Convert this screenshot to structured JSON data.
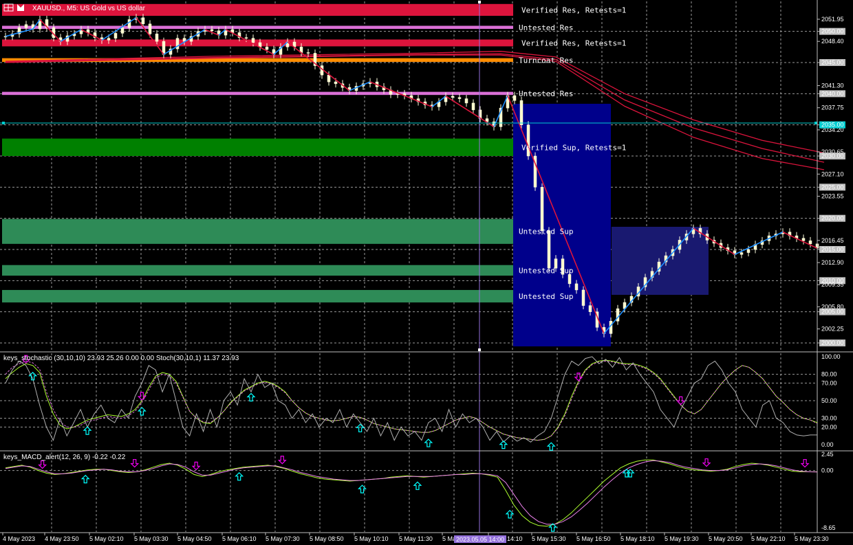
{
  "header": {
    "symbol_title": "XAUUSD., M5:  US Gold vs US dollar",
    "stoch_title": "keys_stochastic (30,10,10) 23.93 25.26 0.00 0.00 Stoch(30,10,1) 11.37 23.93",
    "macd_title": "keys_MACD_alert(12, 26, 9) -0.22 -0.22"
  },
  "colors": {
    "background": "#000000",
    "grid": "#9a9a9a",
    "res_verified": "#dc143c",
    "res_untested": "#da70d6",
    "turncoat": "#ff8c00",
    "sup_verified": "#008000",
    "sup_untested": "#2e8b57",
    "zigzag_up": "#1e90ff",
    "zigzag_down": "#dc143c",
    "ma": "#dc143c",
    "crosshair_h": "#00ced1",
    "crosshair_v": "#9370db",
    "box_a": "#00008b",
    "box_b": "#191970",
    "arrow_up": "#00ffff",
    "arrow_down": "#ee00ee"
  },
  "chart_data": [
    {
      "type": "candlestick",
      "title": "XAUUSD., M5:  US Gold vs US dollar",
      "y_ticks": [
        "2051.95",
        "2050.00",
        "2048.40",
        "2045.00",
        "2041.30",
        "2040.00",
        "2037.75",
        "2035.00",
        "2034.20",
        "2030.65",
        "2030.00",
        "2027.10",
        "2025.00",
        "2023.55",
        "2020.00",
        "2016.45",
        "2015.00",
        "2012.90",
        "2010.00",
        "2009.35",
        "2005.80",
        "2005.00",
        "2002.25",
        "2000.00"
      ],
      "highlighted_ticks": [
        "2050.00",
        "2045.00",
        "2040.00",
        "2035.00",
        "2030.00",
        "2025.00",
        "2020.00",
        "2015.00",
        "2010.00",
        "2005.00",
        "2000.00"
      ],
      "x_labels": [
        "4 May 2023",
        "4 May 23:50",
        "5 May 02:10",
        "5 May 03:30",
        "5 May 04:50",
        "5 May 06:10",
        "5 May 07:30",
        "5 May 08:50",
        "5 May 10:10",
        "5 May 11:30",
        "5 May 12:50",
        "5 May 14:10",
        "5 May 15:30",
        "5 May 16:50",
        "5 May 18:10",
        "5 May 19:30",
        "5 May 20:50",
        "5 May 22:10",
        "5 May 23:30"
      ],
      "crosshair_time": "2023.05.05 14:00",
      "crosshair_price": "2035.00",
      "zones": [
        {
          "kind": "res_verified",
          "label": "Verified Res, Retests=1",
          "from": 2052.5,
          "to": 2054.4
        },
        {
          "kind": "res_untested",
          "label": "Untested Res",
          "from": 2050.4,
          "to": 2050.9
        },
        {
          "kind": "res_verified",
          "label": "Verified Res, Retests=1",
          "from": 2047.6,
          "to": 2048.7
        },
        {
          "kind": "turncoat",
          "label": "Turncoat Res",
          "from": 2045.1,
          "to": 2045.7
        },
        {
          "kind": "res_untested",
          "label": "Untested Res",
          "from": 2039.8,
          "to": 2040.3
        },
        {
          "kind": "sup_verified",
          "label": "Verified Sup, Retests=1",
          "from": 2030.0,
          "to": 2032.8
        },
        {
          "kind": "sup_untested",
          "label": "Untested Sup",
          "from": 2015.9,
          "to": 2019.9
        },
        {
          "kind": "sup_untested",
          "label": "Untested Sup",
          "from": 2010.8,
          "to": 2012.5
        },
        {
          "kind": "sup_untested",
          "label": "Untested Sup",
          "from": 2006.5,
          "to": 2008.5
        }
      ],
      "price_series": [
        2049.2,
        2049.6,
        2050.6,
        2051.1,
        2050.4,
        2051.9,
        2050.6,
        2049.0,
        2048.4,
        2049.3,
        2049.6,
        2050.3,
        2049.8,
        2049.0,
        2048.6,
        2048.9,
        2049.7,
        2050.6,
        2051.9,
        2052.2,
        2051.2,
        2049.6,
        2048.4,
        2046.3,
        2047.2,
        2048.9,
        2048.4,
        2049.2,
        2050.0,
        2050.3,
        2050.1,
        2049.4,
        2050.3,
        2049.8,
        2049.0,
        2048.9,
        2048.2,
        2047.5,
        2047.1,
        2046.3,
        2047.5,
        2048.3,
        2047.5,
        2046.6,
        2046.5,
        2044.5,
        2043.0,
        2041.9,
        2041.6,
        2041.0,
        2040.5,
        2041.2,
        2041.6,
        2041.9,
        2041.1,
        2040.6,
        2039.9,
        2040.0,
        2039.7,
        2039.2,
        2038.7,
        2038.2,
        2037.9,
        2038.7,
        2039.6,
        2039.4,
        2039.2,
        2038.5,
        2037.4,
        2036.0,
        2035.5,
        2034.7,
        2037.7,
        2039.7,
        2038.9,
        2035.0,
        2030.0,
        2025.0,
        2018.0,
        2012.0,
        2013.5,
        2011.0,
        2009.5,
        2008.5,
        2006.0,
        2005.0,
        2002.5,
        2001.5,
        2003.5,
        2005.5,
        2006.5,
        2007.5,
        2009.0,
        2010.5,
        2011.5,
        2013.0,
        2014.0,
        2015.0,
        2016.5,
        2017.5,
        2018.4,
        2017.5,
        2016.5,
        2016.0,
        2015.3,
        2014.8,
        2014.2,
        2014.5,
        2015.0,
        2015.8,
        2016.4,
        2017.2,
        2017.5,
        2017.8,
        2017.2,
        2016.8,
        2016.4,
        2015.9,
        2015.2
      ],
      "moving_averages": [
        {
          "points": [
            [
              0,
              2045.2
            ],
            [
              30,
              2046.0
            ],
            [
              60,
              2046.5
            ],
            [
              72,
              2046.8
            ],
            [
              80,
              2045.9
            ],
            [
              90,
              2040.0
            ],
            [
              100,
              2035.8
            ],
            [
              110,
              2032.5
            ],
            [
              119,
              2030.5
            ]
          ]
        },
        {
          "points": [
            [
              0,
              2045.1
            ],
            [
              30,
              2045.8
            ],
            [
              60,
              2046.3
            ],
            [
              72,
              2046.4
            ],
            [
              80,
              2045.5
            ],
            [
              90,
              2039.0
            ],
            [
              100,
              2034.5
            ],
            [
              110,
              2031.2
            ],
            [
              119,
              2029.0
            ]
          ]
        },
        {
          "points": [
            [
              0,
              2045.0
            ],
            [
              30,
              2045.7
            ],
            [
              60,
              2046.2
            ],
            [
              72,
              2046.2
            ],
            [
              80,
              2045.2
            ],
            [
              90,
              2038.0
            ],
            [
              100,
              2033.0
            ],
            [
              110,
              2029.6
            ],
            [
              119,
              2027.8
            ]
          ]
        }
      ]
    },
    {
      "type": "line",
      "title": "keys_stochastic (30,10,10) 23.93 25.26 0.00 0.00 Stoch(30,10,1) 11.37 23.93",
      "y_ticks": [
        "100.00",
        "80.00",
        "70.00",
        "50.00",
        "30.00",
        "20.00",
        "0.00"
      ],
      "ylim": [
        0,
        100
      ],
      "series": [
        {
          "values": [
            75,
            82,
            88,
            92,
            90,
            82,
            55,
            35,
            22,
            18,
            20,
            24,
            28,
            30,
            32,
            34,
            33,
            32,
            35,
            40,
            50,
            65,
            78,
            82,
            80,
            72,
            55,
            38,
            30,
            25,
            24,
            30,
            38,
            48,
            55,
            62,
            66,
            70,
            72,
            70,
            66,
            60,
            50,
            42,
            36,
            32,
            30,
            28,
            27,
            28,
            30,
            32,
            31,
            28,
            24,
            22,
            20,
            18,
            17,
            16,
            15,
            14,
            14,
            16,
            20,
            24,
            28,
            30,
            32,
            30,
            25,
            20,
            16,
            12,
            10,
            8,
            7,
            6,
            5,
            6,
            10,
            20,
            35,
            55,
            72,
            85,
            92,
            95,
            96,
            95,
            93,
            92,
            92,
            90,
            87,
            82,
            75,
            65,
            55,
            45,
            38,
            35,
            40,
            50,
            60,
            70,
            78,
            85,
            90,
            88,
            82,
            75,
            65,
            55,
            48,
            40,
            34,
            30,
            28,
            25
          ]
        },
        {
          "values": [
            80,
            88,
            92,
            95,
            93,
            86,
            60,
            40,
            26,
            20,
            20,
            22,
            26,
            28,
            30,
            32,
            31,
            30,
            33,
            38,
            48,
            62,
            76,
            80,
            78,
            70,
            54,
            38,
            30,
            26,
            25,
            30,
            38,
            47,
            54,
            61,
            65,
            69,
            71,
            69,
            65,
            59,
            50,
            42,
            36,
            32,
            30,
            28,
            27,
            28,
            30,
            32,
            31,
            28,
            24,
            22,
            20,
            18,
            17,
            16,
            15,
            14,
            14,
            16,
            20,
            24,
            28,
            30,
            32,
            30,
            25,
            20,
            16,
            12,
            10,
            8,
            7,
            6,
            5,
            6,
            10,
            19,
            33,
            52,
            70,
            84,
            91,
            94,
            95,
            94,
            92,
            91,
            91,
            89,
            86,
            81,
            74,
            64,
            54,
            45,
            38,
            35,
            40,
            50,
            60,
            70,
            78,
            85,
            90,
            88,
            82,
            75,
            65,
            55,
            48,
            40,
            34,
            30,
            28,
            24
          ]
        },
        {
          "values": [
            70,
            85,
            95,
            90,
            75,
            45,
            20,
            5,
            30,
            10,
            25,
            40,
            20,
            35,
            45,
            30,
            25,
            40,
            30,
            55,
            70,
            90,
            85,
            60,
            80,
            50,
            20,
            10,
            35,
            15,
            40,
            20,
            50,
            60,
            45,
            75,
            60,
            80,
            65,
            70,
            50,
            45,
            30,
            40,
            25,
            35,
            20,
            30,
            25,
            40,
            20,
            35,
            25,
            15,
            30,
            10,
            25,
            5,
            20,
            10,
            15,
            5,
            25,
            30,
            15,
            40,
            20,
            35,
            25,
            30,
            20,
            5,
            15,
            3,
            10,
            4,
            8,
            3,
            10,
            15,
            30,
            55,
            80,
            95,
            90,
            98,
            100,
            92,
            97,
            88,
            99,
            85,
            93,
            80,
            70,
            60,
            40,
            30,
            20,
            40,
            55,
            70,
            75,
            90,
            95,
            85,
            70,
            60,
            40,
            30,
            20,
            45,
            50,
            30,
            25,
            15,
            11,
            10,
            11,
            11
          ]
        }
      ],
      "arrows_up_x": [
        4,
        12,
        20,
        36,
        52,
        62,
        73,
        80
      ],
      "arrows_down_x": [
        3,
        20,
        84,
        99
      ]
    },
    {
      "type": "line",
      "title": "keys_MACD_alert(12, 26, 9) -0.22 -0.22",
      "y_ticks": [
        "2.45",
        "0.00",
        "-8.65"
      ],
      "ylim": [
        -8.65,
        2.45
      ],
      "series": [
        {
          "values": [
            0.4,
            0.6,
            0.8,
            0.5,
            0.0,
            -0.4,
            -0.6,
            -0.5,
            -0.3,
            -0.1,
            0.1,
            0.2,
            0.2,
            0.0,
            -0.2,
            -0.3,
            -0.2,
            0.1,
            0.5,
            0.9,
            1.1,
            0.8,
            0.2,
            -0.6,
            -0.9,
            -0.6,
            -0.2,
            0.1,
            0.3,
            0.5,
            0.6,
            0.7,
            0.8,
            0.6,
            0.3,
            -0.1,
            -0.5,
            -0.8,
            -1.1,
            -1.3,
            -1.4,
            -1.5,
            -1.6,
            -1.5,
            -1.4,
            -1.3,
            -1.2,
            -1.0,
            -0.9,
            -0.8,
            -0.9,
            -1.0,
            -0.9,
            -0.8,
            -0.7,
            -0.6,
            -0.5,
            -0.4,
            -0.5,
            -0.7,
            -1.0,
            -3.0,
            -5.2,
            -6.8,
            -7.8,
            -8.3,
            -8.4,
            -8.1,
            -7.4,
            -6.4,
            -5.2,
            -4.0,
            -2.8,
            -1.6,
            -0.6,
            0.4,
            1.0,
            1.4,
            1.6,
            1.6,
            1.3,
            1.0,
            0.6,
            0.3,
            0.1,
            0.0,
            -0.1,
            0.0,
            0.2,
            0.6,
            0.9,
            1.1,
            1.0,
            0.8,
            0.5,
            0.2,
            -0.1,
            -0.2,
            -0.2,
            -0.2
          ]
        },
        {
          "values": [
            0.3,
            0.5,
            0.7,
            0.6,
            0.2,
            -0.2,
            -0.5,
            -0.5,
            -0.4,
            -0.2,
            0.0,
            0.1,
            0.2,
            0.1,
            -0.1,
            -0.2,
            -0.2,
            0.0,
            0.3,
            0.7,
            1.0,
            0.9,
            0.5,
            -0.2,
            -0.7,
            -0.7,
            -0.4,
            -0.1,
            0.2,
            0.4,
            0.5,
            0.6,
            0.7,
            0.7,
            0.4,
            0.1,
            -0.3,
            -0.6,
            -0.9,
            -1.1,
            -1.3,
            -1.4,
            -1.5,
            -1.5,
            -1.4,
            -1.3,
            -1.2,
            -1.1,
            -1.0,
            -0.9,
            -0.9,
            -0.9,
            -0.9,
            -0.8,
            -0.7,
            -0.6,
            -0.6,
            -0.5,
            -0.5,
            -0.6,
            -0.8,
            -1.8,
            -3.6,
            -5.4,
            -6.8,
            -7.7,
            -8.1,
            -8.1,
            -7.7,
            -7.0,
            -6.0,
            -4.9,
            -3.7,
            -2.5,
            -1.4,
            -0.4,
            0.4,
            0.9,
            1.3,
            1.5,
            1.4,
            1.2,
            0.8,
            0.5,
            0.3,
            0.1,
            0.0,
            0.0,
            0.1,
            0.4,
            0.7,
            0.9,
            1.0,
            0.9,
            0.7,
            0.4,
            0.1,
            -0.1,
            -0.2,
            -0.22
          ]
        }
      ],
      "arrows_up_x": [
        13,
        38,
        58,
        67,
        82,
        89,
        101,
        101.6
      ],
      "arrows_down_x": [
        6,
        21,
        31,
        45,
        114,
        130
      ]
    }
  ]
}
